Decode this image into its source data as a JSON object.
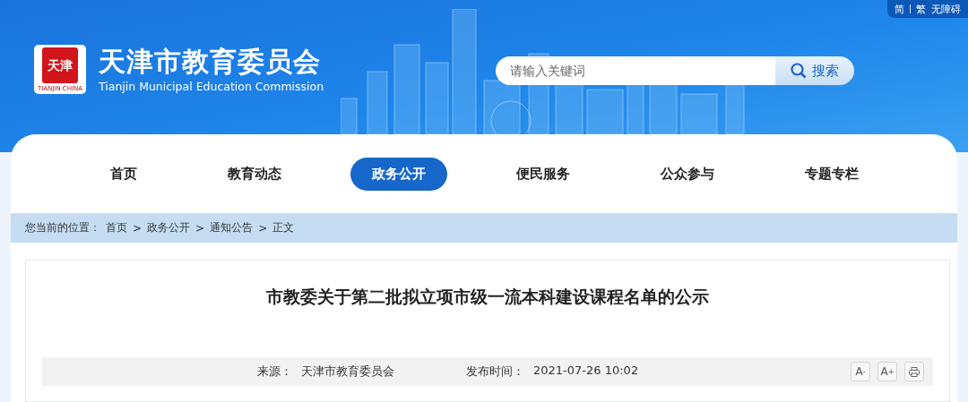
{
  "top_links": [
    {
      "label": "简"
    },
    {
      "label": "繁"
    },
    {
      "label": "无障碍"
    }
  ],
  "logo": {
    "seal_text": "天津",
    "seal_caption": "TIANJIN·CHINA",
    "title": "天津市教育委员会",
    "subtitle": "Tianjin Municipal Education Commission"
  },
  "search": {
    "placeholder": "请输入关键词",
    "button": "搜索"
  },
  "nav": [
    {
      "label": "首页",
      "selected": false
    },
    {
      "label": "教育动态",
      "selected": false
    },
    {
      "label": "政务公开",
      "selected": true
    },
    {
      "label": "便民服务",
      "selected": false
    },
    {
      "label": "公众参与",
      "selected": false
    },
    {
      "label": "专题专栏",
      "selected": false
    }
  ],
  "breadcrumb": {
    "prefix": "您当前的位置：",
    "items": [
      "首页",
      "政务公开",
      "通知公告",
      "正文"
    ],
    "separator": ">"
  },
  "article": {
    "title": "市教委关于第二批拟立项市级一流本科建设课程名单的公示",
    "source_label": "来源：",
    "source": "天津市教育委员会",
    "time_label": "发布时间：",
    "time": "2021-07-26 10:02"
  },
  "tools": [
    {
      "kind": "font_smaller",
      "label": "A",
      "mark": "-"
    },
    {
      "kind": "font_larger",
      "label": "A",
      "mark": "+"
    },
    {
      "kind": "print"
    }
  ]
}
